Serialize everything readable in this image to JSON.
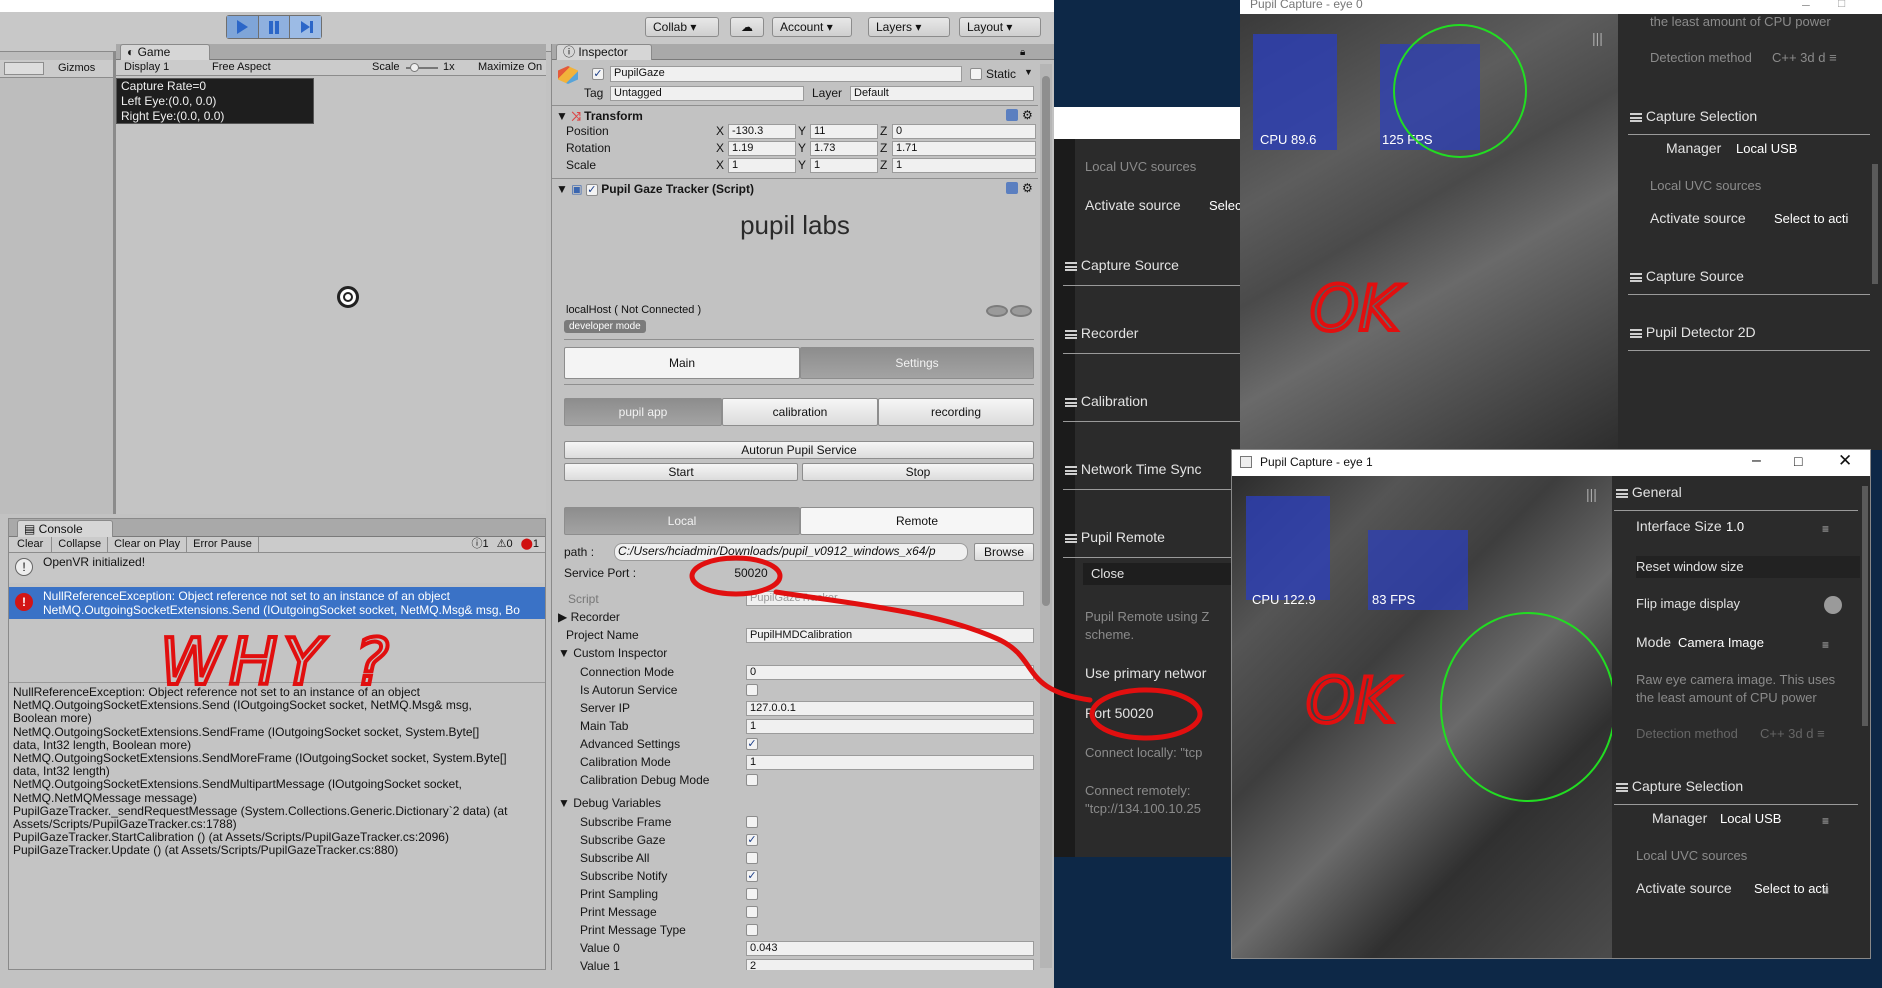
{
  "toolbar": {
    "collab": "Collab ▾",
    "account": "Account",
    "layers": "Layers",
    "layout": "Layout"
  },
  "game": {
    "tab": "Game",
    "display": "Display 1",
    "aspect": "Free Aspect",
    "scale_label": "Scale",
    "scale_value": "1x",
    "maximize": "Maximize On",
    "overlay": [
      "Capture Rate=0",
      "Left Eye:(0.0, 0.0)",
      "Right Eye:(0.0, 0.0)"
    ],
    "gizmos": "Gizmos"
  },
  "console": {
    "tab": "Console",
    "buttons": [
      "Clear",
      "Collapse",
      "Clear on Play",
      "Error Pause"
    ],
    "counts": {
      "info": "1",
      "warn": "0",
      "error": "1"
    },
    "row1": "OpenVR initialized!",
    "row2a": "NullReferenceException: Object reference not set to an instance of an object",
    "row2b": "NetMQ.OutgoingSocketExtensions.Send (IOutgoingSocket socket, NetMQ.Msg& msg, Bo",
    "trace": [
      "NullReferenceException: Object reference not set to an instance of an object",
      "NetMQ.OutgoingSocketExtensions.Send (IOutgoingSocket socket, NetMQ.Msg& msg,",
      "Boolean more)",
      "NetMQ.OutgoingSocketExtensions.SendFrame (IOutgoingSocket socket, System.Byte[]",
      "data, Int32 length, Boolean more)",
      "NetMQ.OutgoingSocketExtensions.SendMoreFrame (IOutgoingSocket socket, System.Byte[]",
      "data, Int32 length)",
      "NetMQ.OutgoingSocketExtensions.SendMultipartMessage (IOutgoingSocket socket,",
      "NetMQ.NetMQMessage message)",
      "PupilGazeTracker._sendRequestMessage (System.Collections.Generic.Dictionary`2 data) (at",
      "Assets/Scripts/PupilGazeTracker.cs:1788)",
      "PupilGazeTracker.StartCalibration () (at Assets/Scripts/PupilGazeTracker.cs:2096)",
      "PupilGazeTracker.Update () (at Assets/Scripts/PupilGazeTracker.cs:880)"
    ]
  },
  "inspector": {
    "tab": "Inspector",
    "object_name": "PupilGaze",
    "static": "Static",
    "tag_label": "Tag",
    "tag": "Untagged",
    "layer_label": "Layer",
    "layer": "Default",
    "transform": "Transform",
    "rows": [
      {
        "label": "Position",
        "x": "-130.3",
        "y": "11",
        "z": "0"
      },
      {
        "label": "Rotation",
        "x": "1.19",
        "y": "1.73",
        "z": "1.71"
      },
      {
        "label": "Scale",
        "x": "1",
        "y": "1",
        "z": "1"
      }
    ],
    "script_title": "Pupil Gaze Tracker (Script)",
    "logo": "pupil labs",
    "host": "localHost ( Not Connected )",
    "dev": "developer mode",
    "tabs_main": [
      "Main",
      "Settings"
    ],
    "tabs_sub": [
      "pupil app",
      "calibration",
      "recording"
    ],
    "autorun": "Autorun Pupil Service",
    "start": "Start",
    "stop": "Stop",
    "tabs_loc": [
      "Local",
      "Remote"
    ],
    "path_label": "path :",
    "path": "C:/Users/hciadmin/Downloads/pupil_v0912_windows_x64/p",
    "browse": "Browse",
    "port_label": "Service Port :",
    "port": "50020",
    "script_label": "Script",
    "script_value": "PupilGazeTracker",
    "recorder": "Recorder",
    "project_label": "Project Name",
    "project": "PupilHMDCalibration",
    "custom": "Custom Inspector",
    "props": [
      {
        "label": "Connection Mode",
        "value": "0"
      },
      {
        "label": "Is Autorun Service",
        "check": ""
      },
      {
        "label": "Server IP",
        "value": "127.0.0.1"
      },
      {
        "label": "Main Tab",
        "value": "1"
      },
      {
        "label": "Advanced Settings",
        "check": "✓"
      },
      {
        "label": "Calibration Mode",
        "value": "1"
      },
      {
        "label": "Calibration Debug Mode",
        "check": ""
      }
    ],
    "debug": "Debug Variables",
    "dprops": [
      {
        "label": "Subscribe Frame",
        "check": ""
      },
      {
        "label": "Subscribe Gaze",
        "check": "✓"
      },
      {
        "label": "Subscribe All",
        "check": ""
      },
      {
        "label": "Subscribe Notify",
        "check": "✓"
      },
      {
        "label": "Print Sampling",
        "check": ""
      },
      {
        "label": "Print Message",
        "check": ""
      },
      {
        "label": "Print Message Type",
        "check": ""
      },
      {
        "label": "Value 0",
        "value": "0.043"
      },
      {
        "label": "Value 1",
        "value": "2"
      }
    ]
  },
  "world": {
    "items": [
      "Local UVC sources",
      "Activate source",
      "Capture Source",
      "Recorder",
      "Calibration",
      "Network Time Sync",
      "Pupil Remote",
      "Close",
      "Pupil Remote using Z",
      "scheme.",
      "Use primary networ",
      "Port  50020",
      "Connect locally:  \"tcp",
      "Connect remotely:",
      "\"tcp://134.100.10.25"
    ],
    "select": "Selec"
  },
  "eye0": {
    "title": "Pupil Capture - eye 0",
    "cpu": "CPU 89.6",
    "fps": "125 FPS",
    "top_text": "the least amount of CPU power",
    "detection_label": "Detection method",
    "detection": "C++ 3d d",
    "capture_selection": "Capture Selection",
    "manager_label": "Manager",
    "manager": "Local USB",
    "uvc": "Local UVC sources",
    "activate_label": "Activate source",
    "activate": "Select to acti",
    "capture_source": "Capture Source",
    "detector": "Pupil Detector 2D"
  },
  "eye1": {
    "title": "Pupil Capture - eye 1",
    "cpu": "CPU 122.9",
    "fps": "83 FPS",
    "general": "General",
    "iface_label": "Interface Size",
    "iface": "1.0",
    "reset": "Reset window size",
    "flip": "Flip image display",
    "mode_label": "Mode",
    "mode": "Camera Image",
    "desc1": "Raw eye camera image. This uses",
    "desc2": "the least amount of CPU power",
    "detection_label": "Detection method",
    "detection": "C++ 3d d",
    "capture_selection": "Capture Selection",
    "manager_label": "Manager",
    "manager": "Local USB",
    "uvc": "Local UVC sources",
    "activate_label": "Activate source",
    "activate": "Select to acti"
  },
  "annotations": {
    "why": "WHY ?",
    "ok1": "OK",
    "ok2": "OK"
  }
}
